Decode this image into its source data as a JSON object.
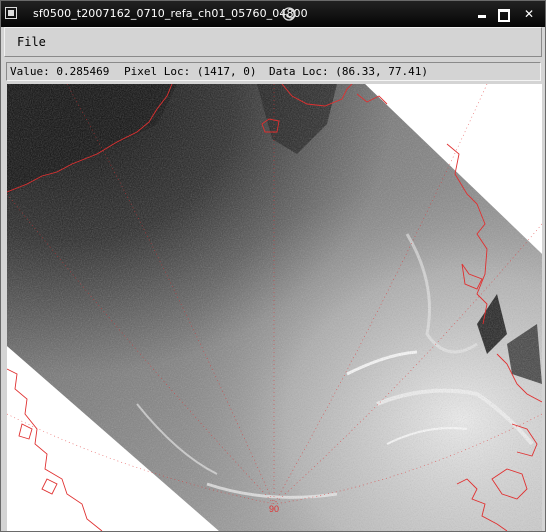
{
  "window": {
    "title": "sf0500_t2007162_0710_refa_ch01_05760_04800",
    "icons": [
      "window-menu-icon",
      "swirl-icon",
      "minimize-icon",
      "maximize-icon",
      "close-icon"
    ]
  },
  "menubar": {
    "file_label": "File"
  },
  "status": {
    "value": "Value: 0.285469",
    "pixel_loc": "Pixel Loc: (1417, 0)",
    "data_loc": "Data Loc: (86.33, 77.41)"
  },
  "image": {
    "latitude_label": "90",
    "coastline_color": "#e03030",
    "graticule_color": "#e03030"
  }
}
